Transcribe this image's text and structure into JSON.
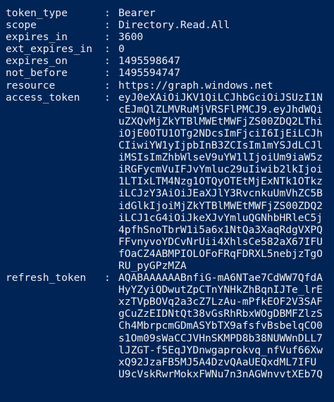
{
  "console": {
    "background": "#012456",
    "foreground": "#EEEDF0",
    "separator": ":",
    "fields": [
      {
        "key": "token_type",
        "lines": [
          "Bearer"
        ]
      },
      {
        "key": "scope",
        "lines": [
          "Directory.Read.All"
        ]
      },
      {
        "key": "expires_in",
        "lines": [
          "3600"
        ]
      },
      {
        "key": "ext_expires_in",
        "lines": [
          "0"
        ]
      },
      {
        "key": "expires_on",
        "lines": [
          "1495598647"
        ]
      },
      {
        "key": "not_before",
        "lines": [
          "1495594747"
        ]
      },
      {
        "key": "resource",
        "lines": [
          "https://graph.windows.net"
        ]
      },
      {
        "key": "access_token",
        "lines": [
          "eyJ0eXAiOiJKV1QiLCJhbGciOiJSUzI1N",
          "cEJmQlZLMVRuMjVRSFlPMCJ9.eyJhdWQi",
          "uZXQvMjZkYTBlMWEtMWFjZS00ZDQ2LThi",
          "iOjE0OTU1OTg2NDcsImFjciI6IjEiLCJh",
          "CIiwiYW1yIjpbInB3ZCIsIm1mYSJdLCJl",
          "iMSIsImZhbWlseV9uYW1lIjoiUm9iaW5z",
          "iRGFycmVuIFJvYmluc29uIiwib2lkIjoi",
          "1LTIxLTM4Nzg1OTQyOTEtMjExNTk1OTkz",
          "iLCJzY3AiOiJEaXJlY3RvcnkuUmVhZC5B",
          "idGlkIjoiMjZkYTBlMWEtMWFjZS00ZDQ2",
          "iLCJ1cG4iOiJkeXJvYmluQGNhbHRleC5j",
          "4pfhSnoTbrW1i5a6x1NtQa3XaqRdgVXPQ",
          "FFvnyvoYDCvNrUii4XhlsCe582aX67IFU",
          "fOaCZ4ABMPIOLOFoFRqFDRXL5nebjzTgO",
          "RU_pyGPzMZA"
        ]
      },
      {
        "key": "refresh_token",
        "lines": [
          "AQABAAAAAABnfiG-mA6NTae7CdWW7QfdA",
          "HyYZyiQDwutZpCTnYNHkZhBqnIJTe_lrE",
          "xzTVpBOVq2a3cZ7LzAu-mPfkEOF2V3SAF",
          "gCuZzEIDNtQt38vGsRhRbxWOgDBMFZlzS",
          "Ch4MbrpcmGDmASYbTX9afsfvBsbelqCO0",
          "s1Om09sWaCCJVHnSKMPD8b38NUWWnDLL7",
          "lJZGT-f5EqJYDnwgaprokvq_nfVuf66Xw",
          "xQ92JzaFB5MJ5A4DzvQAaUEQxdML7IFU",
          "U9cVskRwrMokxFWNu7n3nAGWnvvtXEb7Q"
        ]
      }
    ]
  }
}
